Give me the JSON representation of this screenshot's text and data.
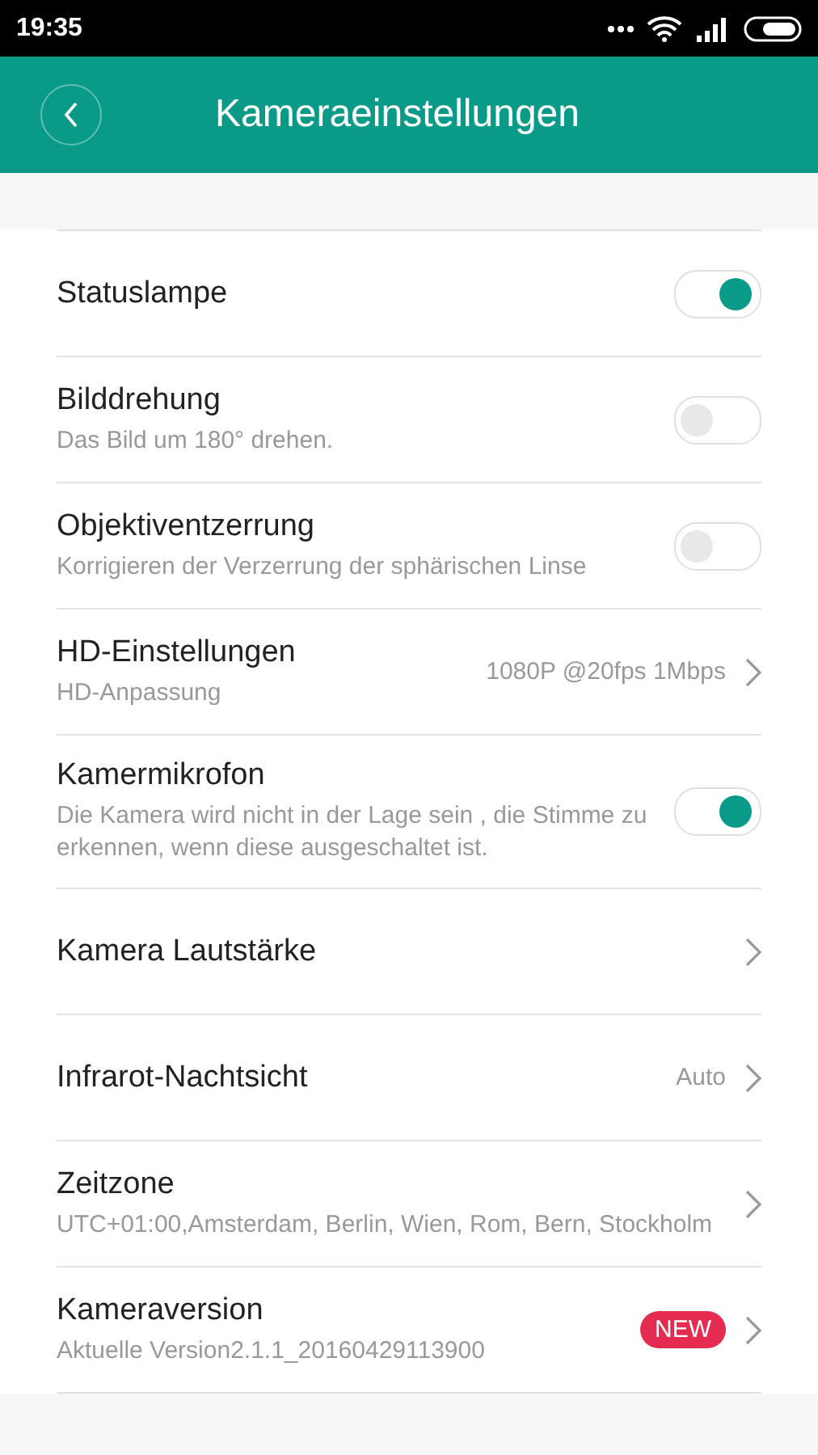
{
  "status_bar": {
    "time": "19:35"
  },
  "header": {
    "title": "Kameraeinstellungen"
  },
  "settings": [
    {
      "kind": "toggle",
      "title": "Statuslampe",
      "on": true
    },
    {
      "kind": "toggle",
      "title": "Bilddrehung",
      "subtitle": "Das Bild um 180° drehen.",
      "on": false
    },
    {
      "kind": "toggle",
      "title": "Objektiventzerrung",
      "subtitle": "Korrigieren der Verzerrung der sphärischen Linse",
      "on": false
    },
    {
      "kind": "link",
      "title": "HD-Einstellungen",
      "subtitle": "HD-Anpassung",
      "value": "1080P @20fps 1Mbps"
    },
    {
      "kind": "toggle",
      "title": "Kamermikrofon",
      "subtitle": "Die Kamera wird nicht in der Lage sein , die Stimme zu erkennen, wenn diese ausgeschaltet ist.",
      "on": true
    },
    {
      "kind": "link",
      "title": "Kamera Lautstärke"
    },
    {
      "kind": "link",
      "title": "Infrarot-Nachtsicht",
      "value": "Auto"
    },
    {
      "kind": "link",
      "title": "Zeitzone",
      "subtitle": "UTC+01:00,Amsterdam, Berlin, Wien, Rom, Bern, Stockholm"
    },
    {
      "kind": "link",
      "title": "Kameraversion",
      "subtitle": "Aktuelle Version2.1.1_20160429113900",
      "badge": "NEW"
    }
  ]
}
